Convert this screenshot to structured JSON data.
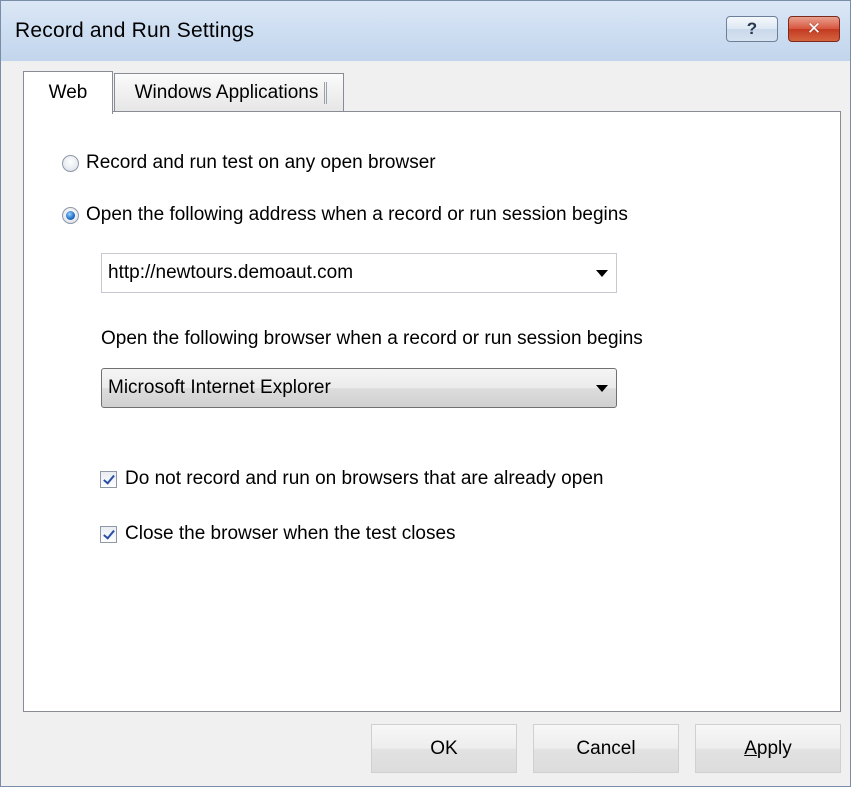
{
  "window": {
    "title": "Record and Run Settings",
    "help_glyph": "?",
    "close_glyph": "✕",
    "help_icon": "question-mark-icon",
    "close_icon": "close-x-icon",
    "close_color": "#c33a21"
  },
  "tabs": [
    {
      "label": "Web",
      "selected": true
    },
    {
      "label": "Windows Applications",
      "selected": false
    }
  ],
  "web": {
    "radio_any_browser": {
      "label": "Record and run test on any open browser",
      "checked": false
    },
    "radio_open_address": {
      "label": "Open the following address when a record or run session begins",
      "checked": true
    },
    "address_value": "http://newtours.demoaut.com",
    "browser_label": "Open the following browser when a record or run session begins",
    "browser_value": "Microsoft Internet Explorer",
    "check_no_open": {
      "label": "Do not record and run on browsers that are already open",
      "checked": true
    },
    "check_close": {
      "label": "Close the browser when the test closes",
      "checked": true
    }
  },
  "buttons": {
    "ok": "OK",
    "cancel": "Cancel",
    "apply_first": "A",
    "apply_rest": "pply"
  }
}
